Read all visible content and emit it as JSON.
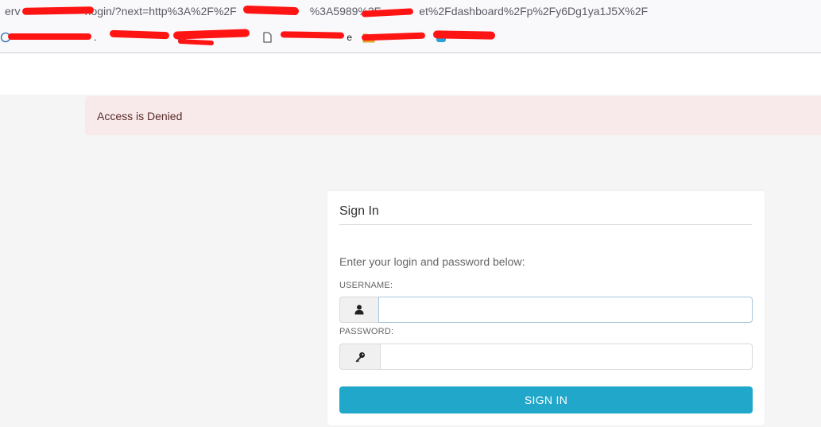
{
  "browser": {
    "url_visible_start": "erv",
    "url_visible_mid": "/login/?next=http%3A%2F%2F",
    "url_visible_mid2": "%3A5989%2F",
    "url_visible_end": "et%2Fdashboard%2Fp%2Fy6Dg1ya1J5X%2F",
    "bookmarks": [
      {
        "label": "",
        "icon": "globe-icon"
      },
      {
        "label": "",
        "icon": "page-icon"
      },
      {
        "label": "",
        "icon": "grid-icon"
      },
      {
        "label": "e",
        "icon": "document-icon"
      },
      {
        "label": "",
        "icon": "folder-icon"
      },
      {
        "label": "",
        "icon": "app-icon"
      }
    ]
  },
  "alert": {
    "message": "Access is Denied"
  },
  "login": {
    "title": "Sign In",
    "instructions": "Enter your login and password below:",
    "username_label": "USERNAME:",
    "username_value": "",
    "password_label": "PASSWORD:",
    "password_value": "",
    "submit_label": "SIGN IN"
  },
  "colors": {
    "alert_bg": "#f8eaea",
    "alert_text": "#5a2b2b",
    "primary_button": "#20a7c9",
    "page_bg": "#f5f5f5"
  }
}
